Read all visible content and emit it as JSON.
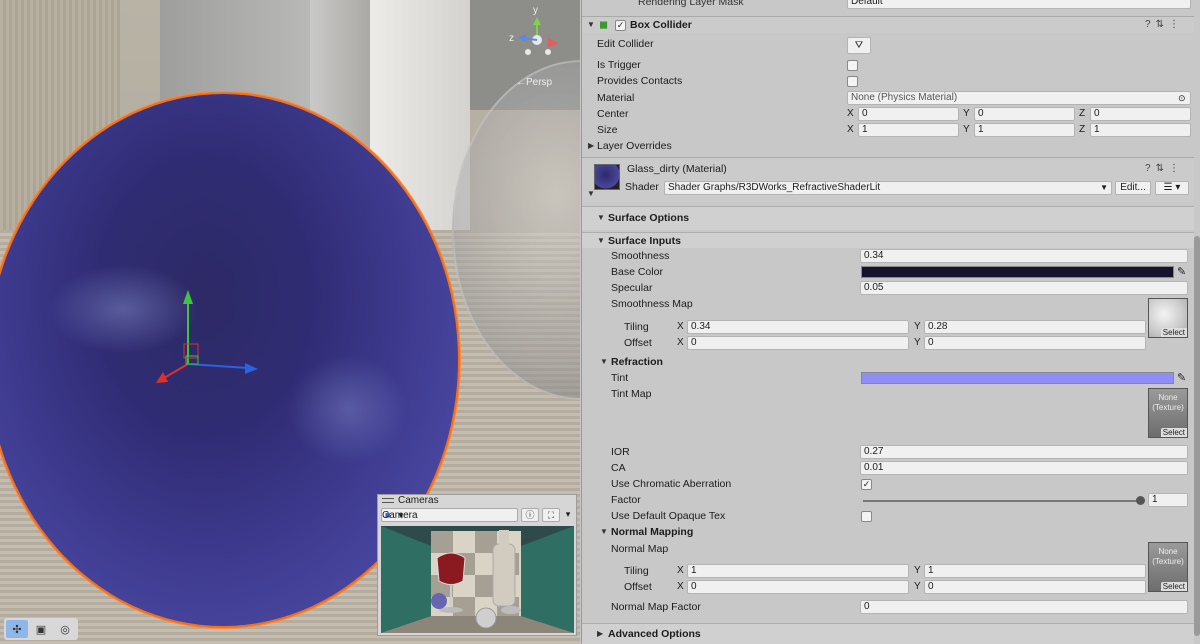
{
  "scene": {
    "persp_label": "←Persp",
    "gizmo_axes": {
      "y": "y",
      "z": "z"
    }
  },
  "cameras_panel": {
    "title": "Cameras",
    "selected_camera": "Camera"
  },
  "inspector": {
    "top_clipped": {
      "label": "Rendering Layer Mask",
      "value": "Default"
    },
    "box_collider": {
      "title": "Box Collider",
      "enabled": true,
      "edit_collider_label": "Edit Collider",
      "is_trigger_label": "Is Trigger",
      "is_trigger": false,
      "provides_contacts_label": "Provides Contacts",
      "provides_contacts": false,
      "material_label": "Material",
      "material_value": "None (Physics Material)",
      "center_label": "Center",
      "center": {
        "x": "0",
        "y": "0",
        "z": "0"
      },
      "size_label": "Size",
      "size": {
        "x": "1",
        "y": "1",
        "z": "1"
      },
      "layer_overrides_label": "Layer Overrides",
      "axis_labels": {
        "x": "X",
        "y": "Y",
        "z": "Z"
      }
    },
    "material": {
      "name": "Glass_dirty (Material)",
      "shader_label": "Shader",
      "shader_value": "Shader Graphs/R3DWorks_RefractiveShaderLit",
      "edit_label": "Edit..."
    },
    "surface_options": {
      "title": "Surface Options"
    },
    "surface_inputs": {
      "title": "Surface Inputs",
      "smoothness_label": "Smoothness",
      "smoothness": "0.34",
      "base_color_label": "Base Color",
      "base_color": "#15132b",
      "specular_label": "Specular",
      "specular": "0.05",
      "smoothness_map_label": "Smoothness Map",
      "tiling_label": "Tiling",
      "tiling": {
        "x": "0.34",
        "y": "0.28"
      },
      "offset_label": "Offset",
      "offset": {
        "x": "0",
        "y": "0"
      },
      "select_label": "Select"
    },
    "refraction": {
      "title": "Refraction",
      "tint_label": "Tint",
      "tint_color": "#8e8ef5",
      "tint_map_label": "Tint Map",
      "tint_map_none": "None (Texture)",
      "select_label": "Select",
      "ior_label": "IOR",
      "ior": "0.27",
      "ca_label": "CA",
      "ca": "0.01",
      "use_ca_label": "Use Chromatic Aberration",
      "use_ca": true,
      "factor_label": "Factor",
      "factor": "1",
      "factor_level": 1.0,
      "use_default_opaque_label": "Use Default Opaque Tex",
      "use_default_opaque": false
    },
    "normal_mapping": {
      "title": "Normal Mapping",
      "normal_map_label": "Normal Map",
      "normal_map_none": "None (Texture)",
      "select_label": "Select",
      "tiling_label": "Tiling",
      "tiling": {
        "x": "1",
        "y": "1"
      },
      "offset_label": "Offset",
      "offset": {
        "x": "0",
        "y": "0"
      },
      "normal_map_factor_label": "Normal Map Factor",
      "normal_map_factor": "0"
    },
    "advanced_options": {
      "title": "Advanced Options"
    }
  }
}
